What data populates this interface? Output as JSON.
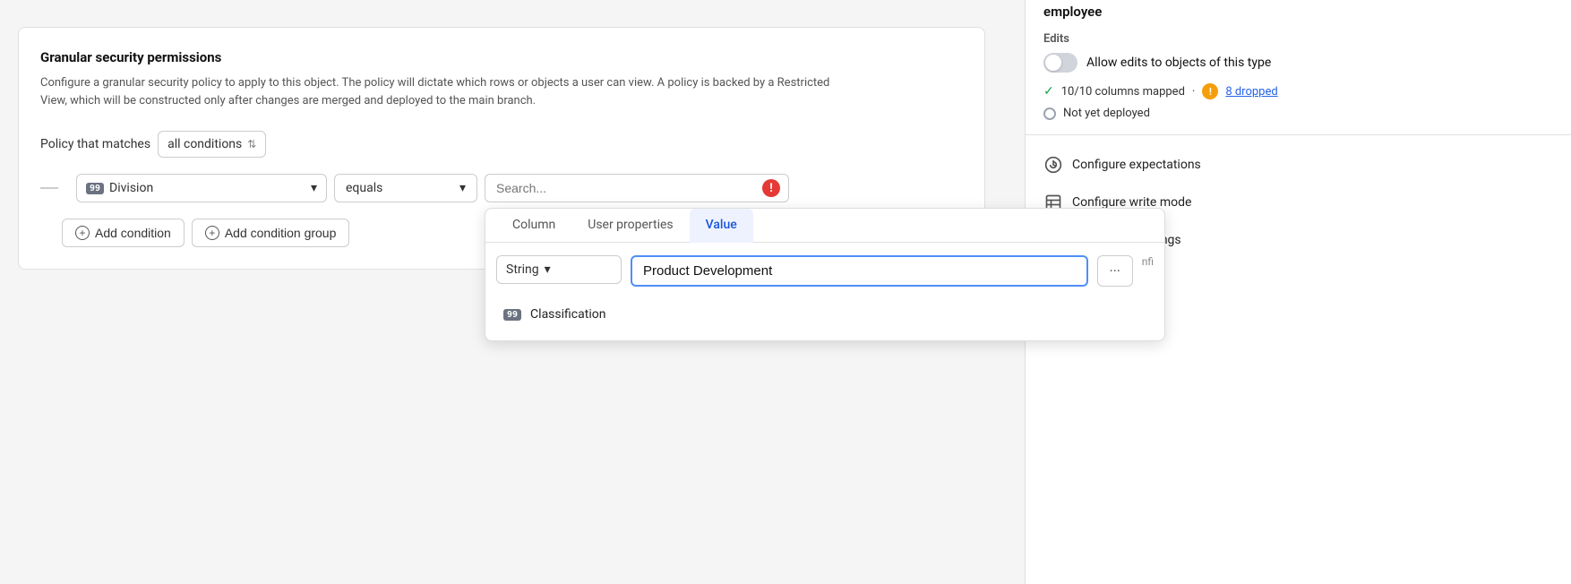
{
  "left": {
    "card": {
      "title": "Granular security permissions",
      "description": "Configure a granular security policy to apply to this object. The policy will dictate which rows or objects a user can view. A policy is backed by a Restricted View, which will be constructed only after changes are merged and deployed to the main branch."
    },
    "policy": {
      "label": "Policy that matches",
      "select_value": "all conditions",
      "chevron": "⇅"
    },
    "condition": {
      "field_label": "99",
      "field_name": "Division",
      "operator": "equals",
      "search_placeholder": "Search..."
    },
    "actions": {
      "add_condition": "Add condition",
      "add_condition_group": "Add condition group"
    },
    "dropdown": {
      "tabs": [
        "Column",
        "User properties",
        "Value"
      ],
      "active_tab": "Value",
      "type_select": "String",
      "type_chevron": "▾",
      "value_input": "Product Development",
      "more_btn": "···",
      "list_items": [
        {
          "icon": "99",
          "label": "Classification"
        }
      ]
    }
  },
  "right": {
    "employee_label": "employee",
    "edits_section": {
      "label": "Edits",
      "allow_edits_text": "Allow edits to objects of this type"
    },
    "mapped": {
      "check": "✓",
      "mapped_text": "10/10 columns mapped",
      "dot": "·",
      "warn": "⚠",
      "dropped_text": "8 dropped"
    },
    "not_deployed": {
      "text": "Not yet deployed"
    },
    "menu_items": [
      {
        "icon": "⟳",
        "label": "Configure expectations"
      },
      {
        "icon": "☰",
        "label": "Configure write mode"
      },
      {
        "icon": "🛡",
        "label": "Configure markings"
      }
    ],
    "nfi": "nfi..."
  }
}
